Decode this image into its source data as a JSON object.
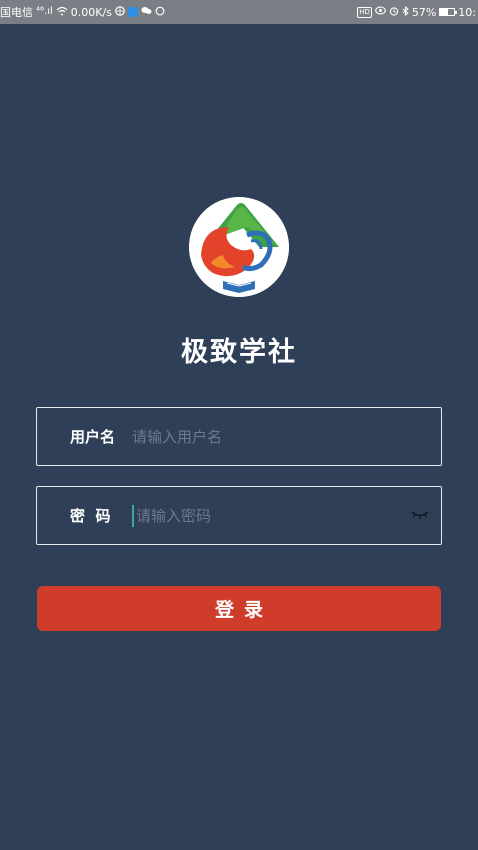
{
  "status_bar": {
    "carrier": "国电信",
    "signal": "⁴⁶.ıl",
    "net_speed": "0.00K/s",
    "hd_badge": "HD",
    "battery_text": "57%",
    "time": "10:"
  },
  "app": {
    "title": "极致学社"
  },
  "form": {
    "username_label": "用户名",
    "username_placeholder": "请输入用户名",
    "password_label": "密  码",
    "password_placeholder": "请输入密码",
    "login_label": "登录"
  },
  "colors": {
    "background": "#2f3f57",
    "login_button": "#cf3d2a",
    "status_bar": "#7a7f86"
  },
  "icons": {
    "password_toggle": "eye-closed-icon"
  }
}
